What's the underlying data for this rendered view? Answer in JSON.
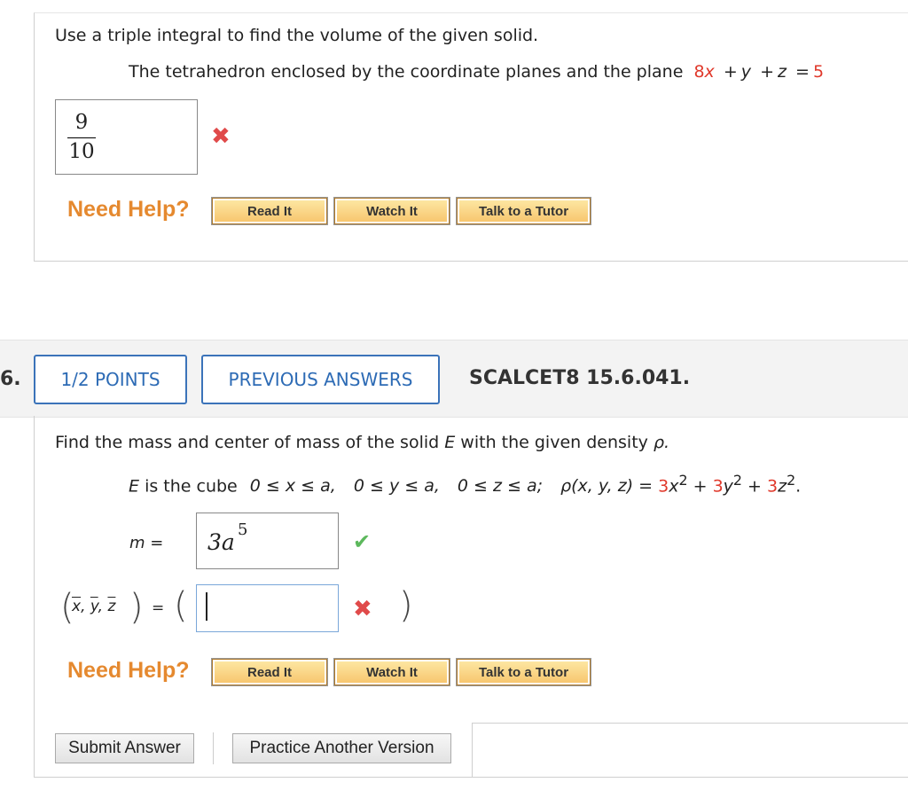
{
  "q1": {
    "prompt": "Use a triple integral to find the volume of the given solid.",
    "description_prefix": "The tetrahedron enclosed by the coordinate planes and the plane",
    "plane": {
      "c1": "8",
      "v1": "x",
      "op1": "+",
      "v2": "y",
      "op2": "+",
      "v3": "z",
      "eq": "=",
      "rhs": "5"
    },
    "answer": {
      "numerator": "9",
      "denominator": "10",
      "status": "incorrect"
    },
    "mark_icon": "x-mark-icon",
    "help": {
      "label": "Need Help?",
      "read": "Read It",
      "watch": "Watch It",
      "tutor": "Talk to a Tutor"
    }
  },
  "q2": {
    "number_fragment": "6.",
    "points": "1/2 POINTS",
    "previous": "PREVIOUS ANSWERS",
    "code": "SCALCET8 15.6.041.",
    "prompt_a": "Find the mass and center of mass of the solid",
    "prompt_E": "E",
    "prompt_b": "with the given density",
    "prompt_rho": "ρ.",
    "cube_E": "E",
    "cube_text": "is the cube",
    "ineq_x": "0 ≤ x ≤ a,",
    "ineq_y": "0 ≤ y ≤ a,",
    "ineq_z": "0 ≤ z ≤ a;",
    "density_lhs": "ρ(x, y, z) =",
    "d1": "3",
    "dv1": "x",
    "dsup1": "2",
    "plus1": "+",
    "d2": "3",
    "dv2": "y",
    "dsup2": "2",
    "plus2": "+",
    "d3": "3",
    "dv3": "z",
    "dsup3": "2",
    "dend": ".",
    "mass_label": "m =",
    "mass_answer_base": "3a",
    "mass_answer_exp": "5",
    "mass_status": "correct",
    "com_label_x": "x",
    "com_label_y": "y",
    "com_label_z": "z",
    "com_eq": "=",
    "com_open": "(",
    "com_value": "",
    "com_close": ")",
    "com_status": "incorrect",
    "help": {
      "label": "Need Help?",
      "read": "Read It",
      "watch": "Watch It",
      "tutor": "Talk to a Tutor"
    },
    "submit": "Submit Answer",
    "practice": "Practice Another Version"
  },
  "colors": {
    "accent_red": "#e0392b",
    "help_orange": "#e5892f",
    "link_blue": "#2d6bb5",
    "correct_green": "#5cb85c"
  }
}
